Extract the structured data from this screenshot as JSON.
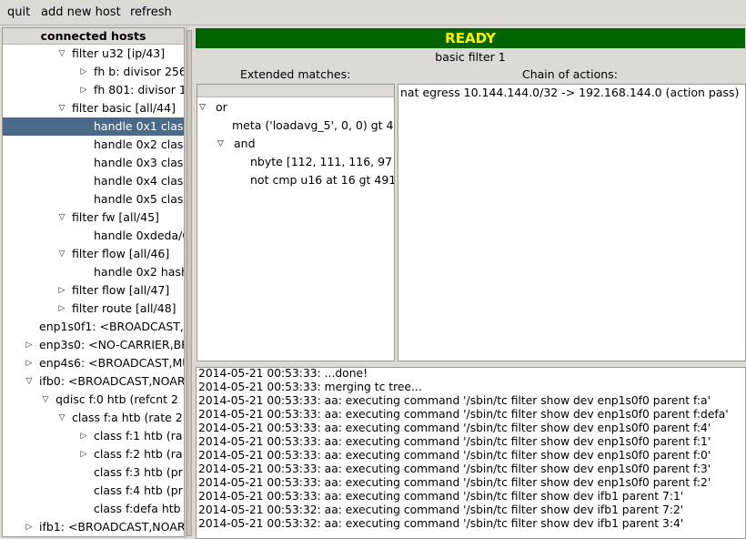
{
  "menu": {
    "quit": "quit",
    "add_host": "add new host",
    "refresh": "refresh"
  },
  "tree": {
    "header": "connected hosts",
    "rows": [
      {
        "arrow": "down",
        "label": "filter u32 [ip/43]"
      },
      {
        "arrow": "right",
        "label": "fh b: divisor 256"
      },
      {
        "arrow": "right",
        "label": "fh 801: divisor 1"
      },
      {
        "arrow": "down",
        "label": "filter basic [all/44]"
      },
      {
        "arrow": "",
        "label": "handle 0x1 class",
        "selected": true
      },
      {
        "arrow": "",
        "label": "handle 0x2 class"
      },
      {
        "arrow": "",
        "label": "handle 0x3 class"
      },
      {
        "arrow": "",
        "label": "handle 0x4 class"
      },
      {
        "arrow": "",
        "label": "handle 0x5 class"
      },
      {
        "arrow": "down",
        "label": "filter fw [all/45]"
      },
      {
        "arrow": "",
        "label": "handle 0xdeda/0"
      },
      {
        "arrow": "down",
        "label": "filter flow [all/46]"
      },
      {
        "arrow": "",
        "label": "handle 0x2 hash"
      },
      {
        "arrow": "right",
        "label": "filter flow [all/47]"
      },
      {
        "arrow": "right",
        "label": "filter route [all/48]"
      },
      {
        "arrow": "",
        "label": "enp1s0f1: <BROADCAST,M"
      },
      {
        "arrow": "right",
        "label": "enp3s0: <NO-CARRIER,BRO"
      },
      {
        "arrow": "right",
        "label": "enp4s6: <BROADCAST,MU"
      },
      {
        "arrow": "down",
        "label": "ifb0: <BROADCAST,NOARP"
      },
      {
        "arrow": "down",
        "label": "qdisc f:0 htb (refcnt 2"
      },
      {
        "arrow": "down",
        "label": "class f:a htb (rate 2"
      },
      {
        "arrow": "right",
        "label": "class f:1 htb (ra"
      },
      {
        "arrow": "right",
        "label": "class f:2 htb (ra"
      },
      {
        "arrow": "",
        "label": "class f:3 htb (pr"
      },
      {
        "arrow": "",
        "label": "class f:4 htb (pr"
      },
      {
        "arrow": "",
        "label": "class f:defa htb"
      },
      {
        "arrow": "right",
        "label": "ifb1: <BROADCAST,NOARP"
      }
    ]
  },
  "status": {
    "label": "READY",
    "color": "#006400",
    "text_color": "#ffff00"
  },
  "detail": {
    "title": "basic filter 1",
    "matches_label": "Extended matches:",
    "actions_label": "Chain of actions:",
    "matches": [
      {
        "arrow": "down",
        "label": "or"
      },
      {
        "arrow": "",
        "label": "meta ('loadavg_5', 0, 0) gt 4"
      },
      {
        "arrow": "down",
        "label": "and"
      },
      {
        "arrow": "",
        "label": "nbyte [112, 111, 116, 97"
      },
      {
        "arrow": "",
        "label": "not cmp u16 at 16 gt 491"
      }
    ],
    "action": "nat egress 10.144.144.0/32 -> 192.168.144.0 (action pass)"
  },
  "log": [
    "2014-05-21 00:53:33: ...done!",
    "2014-05-21 00:53:33: merging tc tree...",
    "2014-05-21 00:53:33: aa: executing command '/sbin/tc filter show dev enp1s0f0 parent f:a'",
    "2014-05-21 00:53:33: aa: executing command '/sbin/tc filter show dev enp1s0f0 parent f:defa'",
    "2014-05-21 00:53:33: aa: executing command '/sbin/tc filter show dev enp1s0f0 parent f:4'",
    "2014-05-21 00:53:33: aa: executing command '/sbin/tc filter show dev enp1s0f0 parent f:1'",
    "2014-05-21 00:53:33: aa: executing command '/sbin/tc filter show dev enp1s0f0 parent f:0'",
    "2014-05-21 00:53:33: aa: executing command '/sbin/tc filter show dev enp1s0f0 parent f:3'",
    "2014-05-21 00:53:33: aa: executing command '/sbin/tc filter show dev enp1s0f0 parent f:2'",
    "2014-05-21 00:53:33: aa: executing command '/sbin/tc filter show dev ifb1 parent 7:1'",
    "2014-05-21 00:53:32: aa: executing command '/sbin/tc filter show dev ifb1 parent 7:2'",
    "2014-05-21 00:53:32: aa: executing command '/sbin/tc filter show dev ifb1 parent 3:4'"
  ]
}
